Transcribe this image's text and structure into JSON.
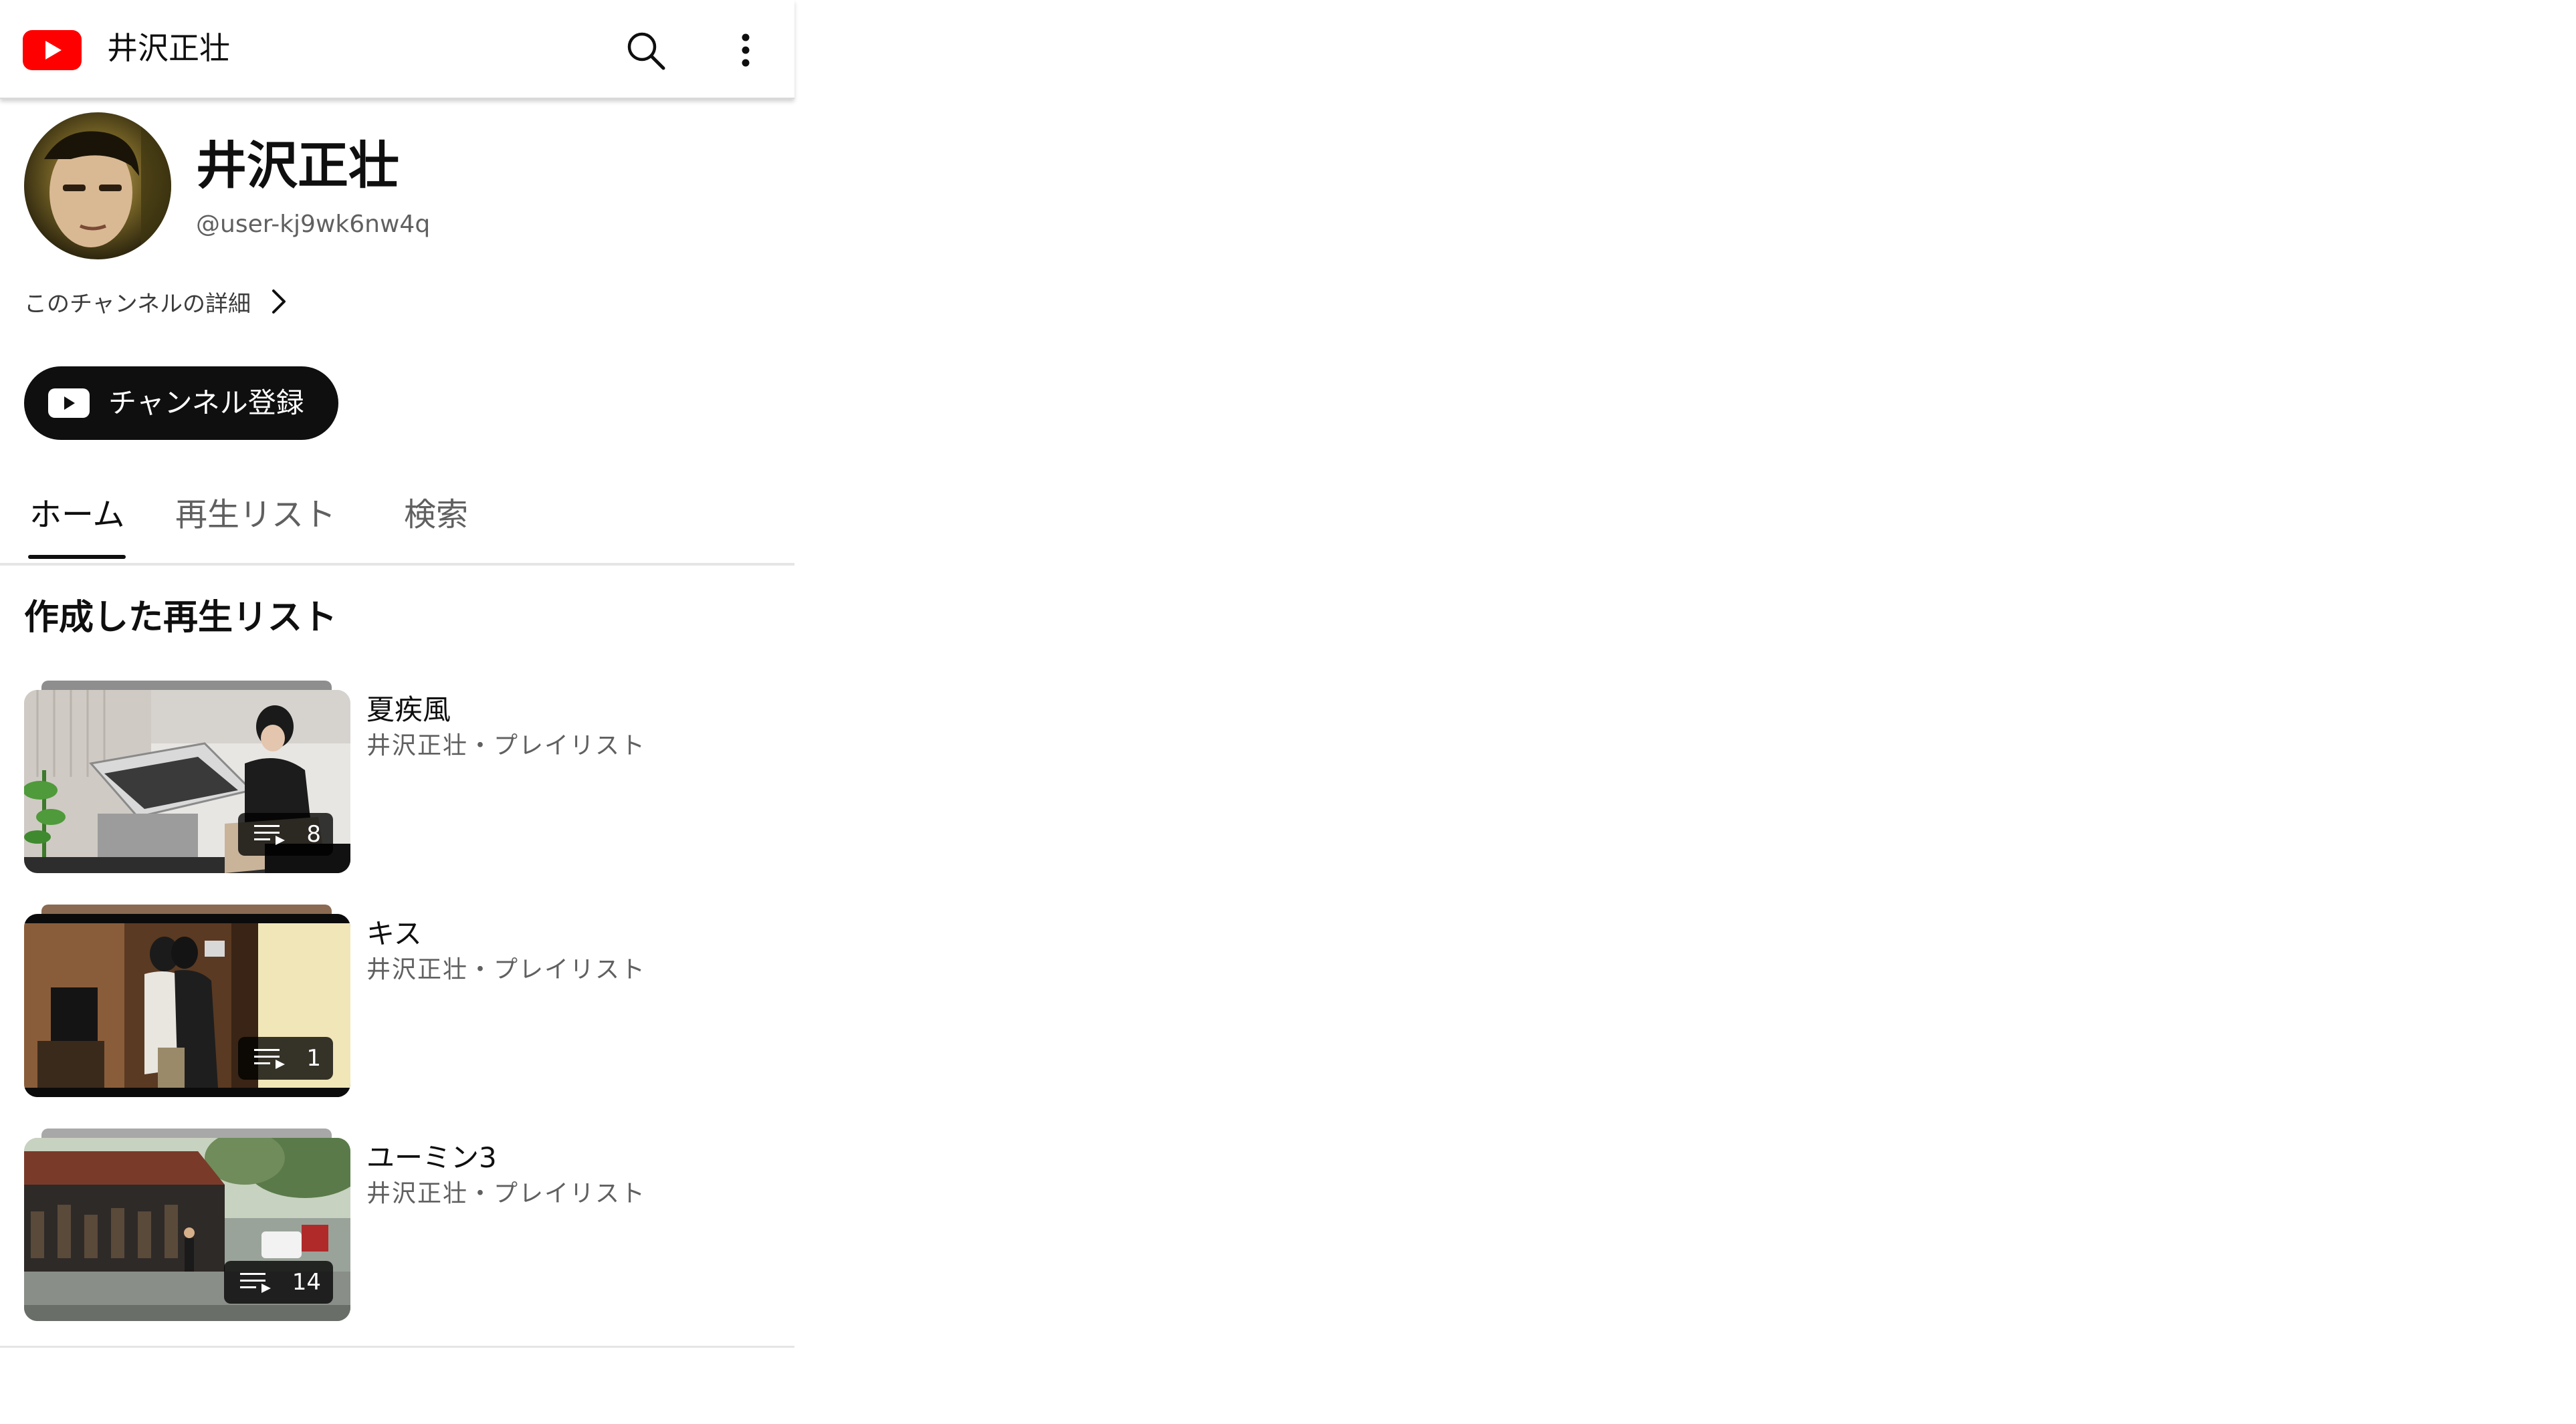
{
  "header": {
    "title": "井沢正壮",
    "logo_icon": "youtube-logo-icon",
    "search_icon": "search-icon",
    "more_icon": "more-vert-icon",
    "brand_color": "#ff0000"
  },
  "channel": {
    "name": "井沢正壮",
    "handle": "@user-kj9wk6nw4q",
    "details_link": "このチャンネルの詳細",
    "subscribe_label": "チャンネル登録"
  },
  "tabs": [
    {
      "label": "ホーム",
      "active": true
    },
    {
      "label": "再生リスト",
      "active": false
    },
    {
      "label": "検索",
      "active": false
    }
  ],
  "section": {
    "title": "作成した再生リスト"
  },
  "playlists": [
    {
      "title": "夏疾風",
      "subtitle": "井沢正壮・プレイリスト",
      "count": "8"
    },
    {
      "title": "キス",
      "subtitle": "井沢正壮・プレイリスト",
      "count": "1"
    },
    {
      "title": "ユーミン3",
      "subtitle": "井沢正壮・プレイリスト",
      "count": "14"
    }
  ]
}
